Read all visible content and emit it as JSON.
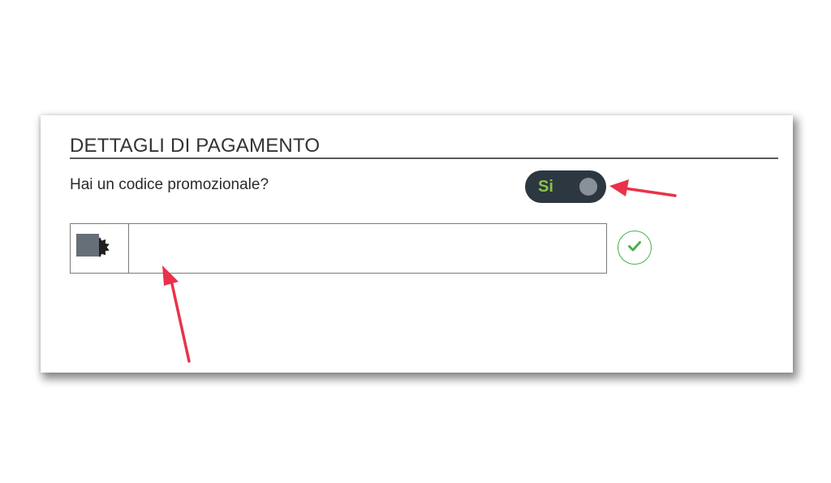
{
  "payment_section": {
    "title": "DETTAGLI DI PAGAMENTO",
    "promo_question": "Hai un codice promozionale?",
    "promo_toggle": {
      "label": "Si",
      "state": "on",
      "label_color": "#8bc34a",
      "track_color": "#2d3740"
    },
    "promo_code_field": {
      "value": "",
      "addon_icon": "badge-icon"
    },
    "confirm_icon": "checkmark-icon",
    "confirm_color": "#4caf50"
  },
  "annotations": {
    "arrow_color": "#e8334a",
    "arrows": [
      "arrow-to-toggle",
      "arrow-to-code-input"
    ]
  }
}
